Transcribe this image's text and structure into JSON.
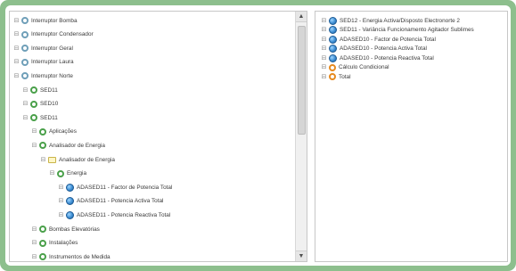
{
  "left_tree": {
    "items": [
      {
        "label": "Interruptor Bomba",
        "level": 0,
        "icon": "ring-gray-icon"
      },
      {
        "label": "Interruptor Condensador",
        "level": 0,
        "icon": "ring-gray-icon"
      },
      {
        "label": "Interruptor Geral",
        "level": 0,
        "icon": "ring-gray-icon"
      },
      {
        "label": "Interruptor Laura",
        "level": 0,
        "icon": "ring-gray-icon"
      },
      {
        "label": "Interruptor Norte",
        "level": 0,
        "icon": "ring-gray-icon"
      },
      {
        "label": "SED11",
        "level": 1,
        "icon": "ring-green-icon"
      },
      {
        "label": "SED10",
        "level": 1,
        "icon": "ring-green-icon"
      },
      {
        "label": "SED11",
        "level": 1,
        "icon": "ring-green-icon"
      },
      {
        "label": "Aplicações",
        "level": 2,
        "icon": "ring-green-icon"
      },
      {
        "label": "Analisador de Energia",
        "level": 2,
        "icon": "ring-green-icon"
      },
      {
        "label": "Analisador de Energia",
        "level": 3,
        "icon": "folder-icon"
      },
      {
        "label": "Energia",
        "level": 4,
        "icon": "ring-green-icon"
      },
      {
        "label": "ADASED11 - Factor de Potencia Total",
        "level": 5,
        "icon": "gauge-icon"
      },
      {
        "label": "ADASED11 - Potencia Activa Total",
        "level": 5,
        "icon": "gauge-icon"
      },
      {
        "label": "ADASED11 - Potencia Reactiva Total",
        "level": 5,
        "icon": "gauge-icon"
      },
      {
        "label": "Bombas Elevatórias",
        "level": 2,
        "icon": "ring-green-icon"
      },
      {
        "label": "Instalações",
        "level": 2,
        "icon": "ring-green-icon"
      },
      {
        "label": "Instrumentos de Medida",
        "level": 2,
        "icon": "ring-green-icon"
      }
    ]
  },
  "right_tree": {
    "items": [
      {
        "label": "SED12 - Energia Activa/Disposto Electronorte 2",
        "icon": "gauge-icon"
      },
      {
        "label": "SED11 - Variância Funcionamento Agitador Sublimes",
        "icon": "gauge-icon"
      },
      {
        "label": "ADASED10 - Factor de Potencia Total",
        "icon": "gauge-icon"
      },
      {
        "label": "ADASED10 - Potencia Activa Total",
        "icon": "gauge-icon"
      },
      {
        "label": "ADASED10 - Potencia Reactiva Total",
        "icon": "gauge-icon"
      },
      {
        "label": "Cálculo Condicional",
        "icon": "ring-orange-icon"
      },
      {
        "label": "Total",
        "icon": "ring-orange-icon"
      }
    ]
  },
  "colors": {
    "frame": "#8dbf8d",
    "green_node": "#4aa04a",
    "orange_node": "#e68a1f",
    "gauge_blue": "#3f8fd4"
  }
}
